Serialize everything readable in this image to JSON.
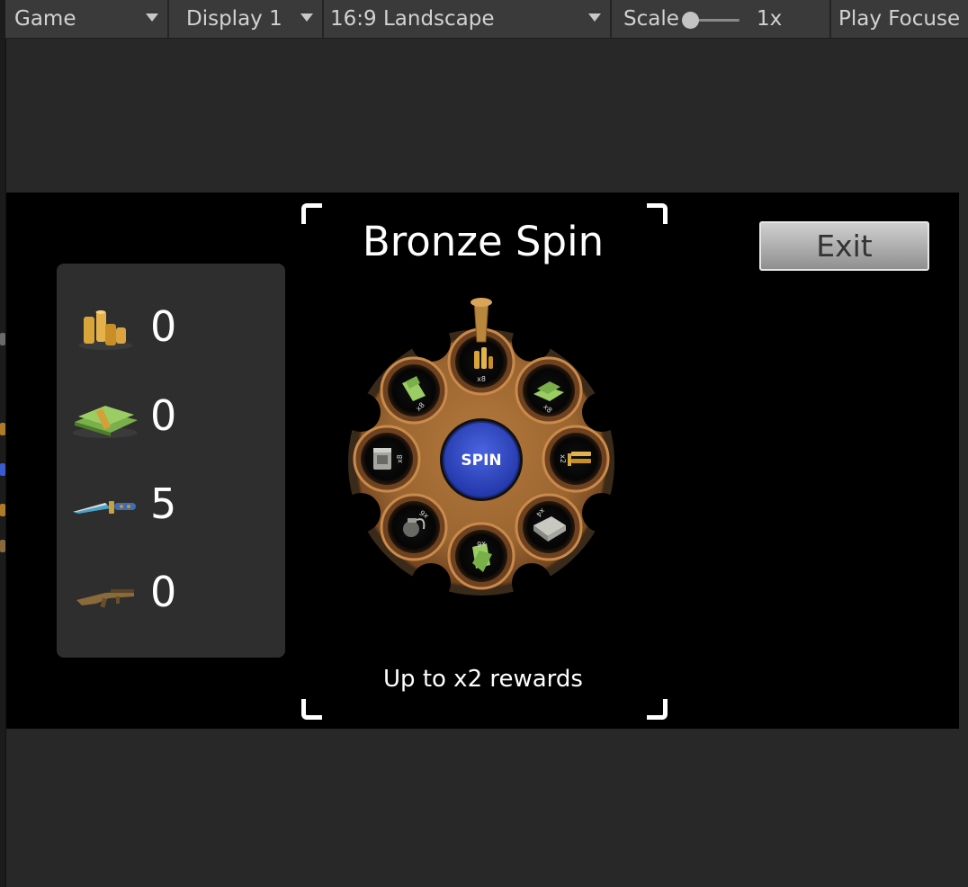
{
  "toolbar": {
    "view": "Game",
    "display": "Display 1",
    "aspect": "16:9 Landscape",
    "scale_label": "Scale",
    "scale_value": "1x",
    "play_mode": "Play Focuse"
  },
  "game": {
    "title": "Bronze Spin",
    "exit_label": "Exit",
    "subtitle": "Up to x2 rewards",
    "spin_label": "SPIN",
    "inventory": [
      {
        "icon": "gold-coins-icon",
        "count": "0"
      },
      {
        "icon": "cash-stack-icon",
        "count": "0"
      },
      {
        "icon": "knife-icon",
        "count": "5"
      },
      {
        "icon": "rifle-icon",
        "count": "0"
      }
    ],
    "slots": [
      {
        "icon": "gold-coins-icon",
        "multiplier": "x8"
      },
      {
        "icon": "cash-stack-icon",
        "multiplier": "x8"
      },
      {
        "icon": "gold-bars-icon",
        "multiplier": "x2"
      },
      {
        "icon": "crate-icon",
        "multiplier": "x4"
      },
      {
        "icon": "cash-stack-icon",
        "multiplier": "x6"
      },
      {
        "icon": "grenade-icon",
        "multiplier": "x6"
      },
      {
        "icon": "crate-icon",
        "multiplier": "x8"
      },
      {
        "icon": "cash-stack-icon",
        "multiplier": "x8"
      }
    ]
  },
  "colors": {
    "wheel_bronze": "#9a6531",
    "spin_button": "#2f47c8",
    "game_background": "#000000",
    "editor_background": "#282828"
  }
}
